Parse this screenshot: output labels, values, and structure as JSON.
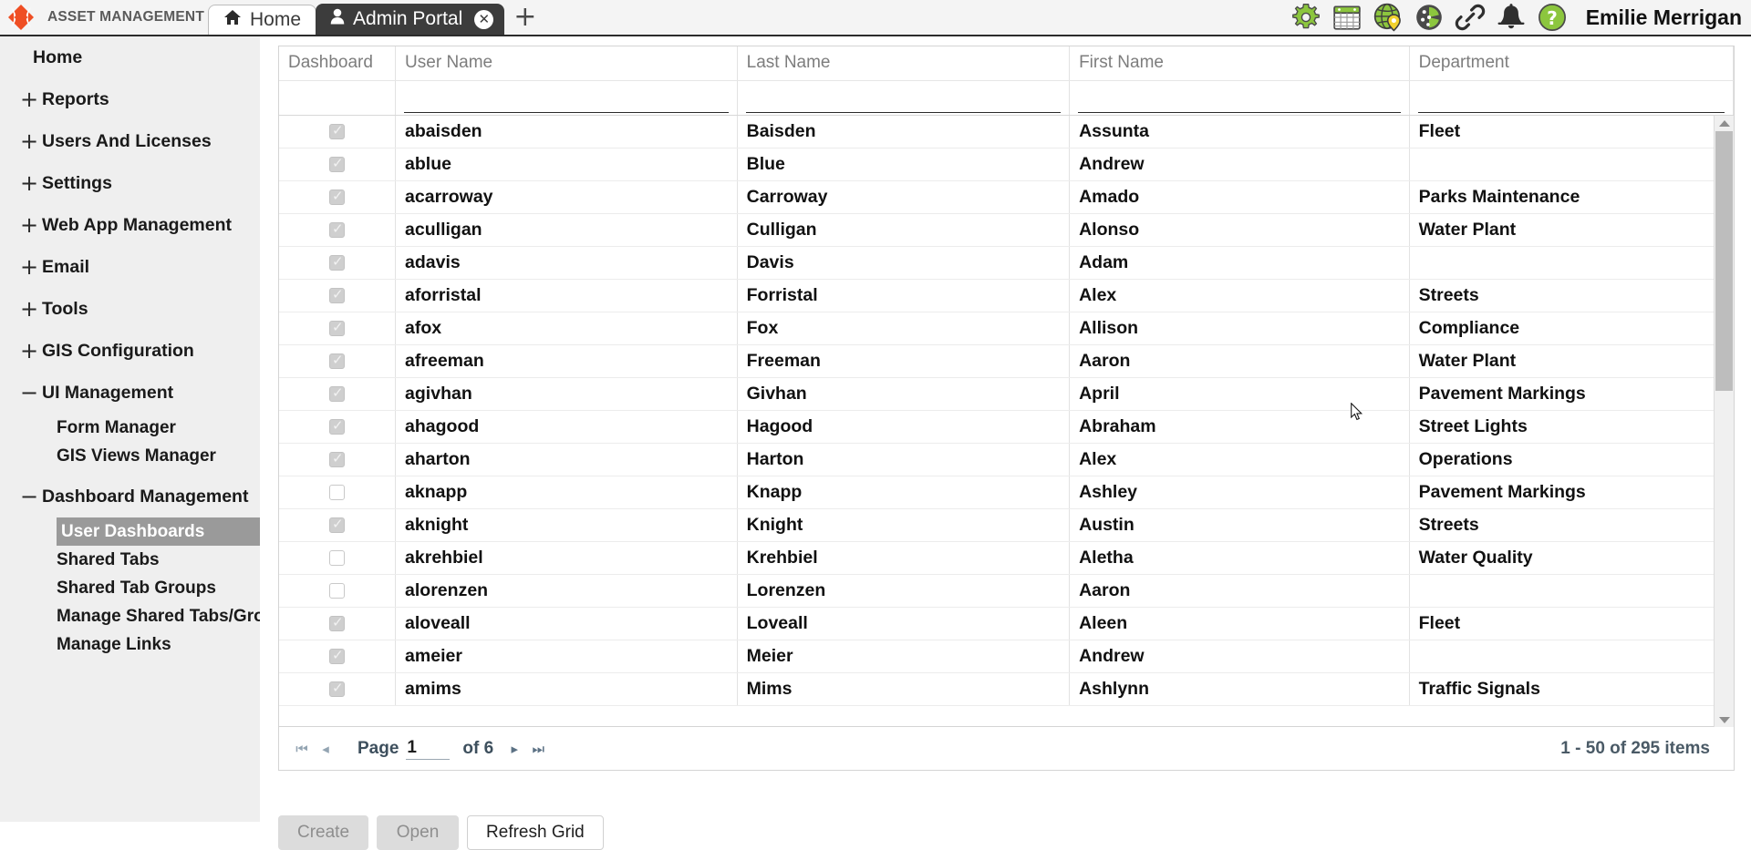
{
  "app": {
    "brand": "ASSET MANAGEMENT",
    "logo_color": "#ef4e23",
    "accent_green": "#8cc63e"
  },
  "header": {
    "tabs": [
      {
        "label": "Home",
        "icon": "home-icon",
        "active": false,
        "closable": false
      },
      {
        "label": "Admin Portal",
        "icon": "user-icon",
        "active": true,
        "closable": true
      }
    ],
    "add_tab_label": "+",
    "close_label": "✕",
    "icons": [
      "gear-icon",
      "calendar-icon",
      "globe-location-icon",
      "compass-icon",
      "link-icon",
      "bell-icon",
      "help-icon"
    ],
    "user_name": "Emilie Merrigan"
  },
  "sidebar": {
    "items": [
      {
        "label": "Home",
        "expander": "",
        "level": 0
      },
      {
        "label": "Reports",
        "expander": "+",
        "level": 0
      },
      {
        "label": "Users And Licenses",
        "expander": "+",
        "level": 0
      },
      {
        "label": "Settings",
        "expander": "+",
        "level": 0
      },
      {
        "label": "Web App Management",
        "expander": "+",
        "level": 0
      },
      {
        "label": "Email",
        "expander": "+",
        "level": 0
      },
      {
        "label": "Tools",
        "expander": "+",
        "level": 0
      },
      {
        "label": "GIS Configuration",
        "expander": "+",
        "level": 0
      },
      {
        "label": "UI Management",
        "expander": "−",
        "level": 0
      },
      {
        "label": "Form Manager",
        "expander": "",
        "level": 1,
        "selected": false
      },
      {
        "label": "GIS Views Manager",
        "expander": "",
        "level": 1,
        "selected": false
      },
      {
        "label": "Dashboard Management",
        "expander": "−",
        "level": 0
      },
      {
        "label": "User Dashboards",
        "expander": "",
        "level": 1,
        "selected": true
      },
      {
        "label": "Shared Tabs",
        "expander": "",
        "level": 1,
        "selected": false
      },
      {
        "label": "Shared Tab Groups",
        "expander": "",
        "level": 1,
        "selected": false
      },
      {
        "label": "Manage Shared Tabs/Groups",
        "expander": "",
        "level": 1,
        "selected": false
      },
      {
        "label": "Manage Links",
        "expander": "",
        "level": 1,
        "selected": false
      }
    ]
  },
  "grid": {
    "columns": [
      {
        "key": "dashboard",
        "label": "Dashboard",
        "filterable": false
      },
      {
        "key": "user_name",
        "label": "User Name",
        "filterable": true
      },
      {
        "key": "last_name",
        "label": "Last Name",
        "filterable": true
      },
      {
        "key": "first_name",
        "label": "First Name",
        "filterable": true
      },
      {
        "key": "department",
        "label": "Department",
        "filterable": true
      }
    ],
    "filters": {
      "user_name": "",
      "last_name": "",
      "first_name": "",
      "department": ""
    },
    "rows": [
      {
        "dashboard": true,
        "user_name": "abaisden",
        "last_name": "Baisden",
        "first_name": "Assunta",
        "department": "Fleet"
      },
      {
        "dashboard": true,
        "user_name": "ablue",
        "last_name": "Blue",
        "first_name": "Andrew",
        "department": ""
      },
      {
        "dashboard": true,
        "user_name": "acarroway",
        "last_name": "Carroway",
        "first_name": "Amado",
        "department": "Parks Maintenance"
      },
      {
        "dashboard": true,
        "user_name": "aculligan",
        "last_name": "Culligan",
        "first_name": "Alonso",
        "department": "Water Plant"
      },
      {
        "dashboard": true,
        "user_name": "adavis",
        "last_name": "Davis",
        "first_name": "Adam",
        "department": ""
      },
      {
        "dashboard": true,
        "user_name": "aforristal",
        "last_name": "Forristal",
        "first_name": "Alex",
        "department": "Streets"
      },
      {
        "dashboard": true,
        "user_name": "afox",
        "last_name": "Fox",
        "first_name": "Allison",
        "department": "Compliance"
      },
      {
        "dashboard": true,
        "user_name": "afreeman",
        "last_name": "Freeman",
        "first_name": "Aaron",
        "department": "Water Plant"
      },
      {
        "dashboard": true,
        "user_name": "agivhan",
        "last_name": "Givhan",
        "first_name": "April",
        "department": "Pavement Markings"
      },
      {
        "dashboard": true,
        "user_name": "ahagood",
        "last_name": "Hagood",
        "first_name": "Abraham",
        "department": "Street Lights"
      },
      {
        "dashboard": true,
        "user_name": "aharton",
        "last_name": "Harton",
        "first_name": "Alex",
        "department": "Operations"
      },
      {
        "dashboard": false,
        "user_name": "aknapp",
        "last_name": "Knapp",
        "first_name": "Ashley",
        "department": "Pavement Markings"
      },
      {
        "dashboard": true,
        "user_name": "aknight",
        "last_name": "Knight",
        "first_name": "Austin",
        "department": "Streets"
      },
      {
        "dashboard": false,
        "user_name": "akrehbiel",
        "last_name": "Krehbiel",
        "first_name": "Aletha",
        "department": "Water Quality"
      },
      {
        "dashboard": false,
        "user_name": "alorenzen",
        "last_name": "Lorenzen",
        "first_name": "Aaron",
        "department": ""
      },
      {
        "dashboard": true,
        "user_name": "aloveall",
        "last_name": "Loveall",
        "first_name": "Aleen",
        "department": "Fleet"
      },
      {
        "dashboard": true,
        "user_name": "ameier",
        "last_name": "Meier",
        "first_name": "Andrew",
        "department": ""
      },
      {
        "dashboard": true,
        "user_name": "amims",
        "last_name": "Mims",
        "first_name": "Ashlynn",
        "department": "Traffic Signals"
      }
    ]
  },
  "pager": {
    "first_label": "⏮",
    "prev_label": "◂",
    "next_label": "▸",
    "last_label": "⏭",
    "page_label": "Page",
    "page_value": "1",
    "of_label": "of 6",
    "item_count": "1 - 50 of 295 items"
  },
  "actions": {
    "create_label": "Create",
    "open_label": "Open",
    "refresh_label": "Refresh Grid"
  }
}
